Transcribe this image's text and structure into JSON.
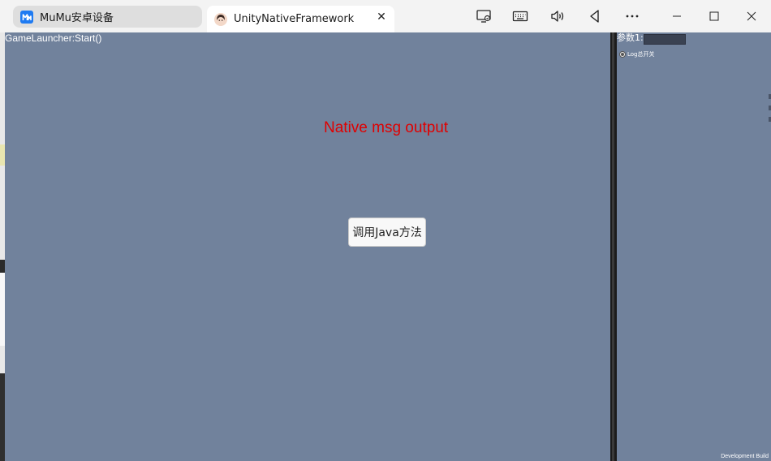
{
  "titlebar": {
    "tabs": [
      {
        "label": "MuMu安卓设备",
        "icon": "mumu-logo-icon"
      },
      {
        "label": "UnityNativeFramework",
        "icon": "avatar-icon",
        "close": "✕"
      }
    ],
    "toolbar_icons": [
      "screen-share-icon",
      "keyboard-icon",
      "volume-icon",
      "back-icon",
      "more-icon"
    ],
    "window_controls": [
      "minimize-icon",
      "maximize-icon",
      "close-icon"
    ]
  },
  "game": {
    "launcher_text": "GameLauncher:Start()",
    "native_msg": "Native msg output",
    "java_button": "调用Java方法",
    "colors": {
      "background": "#71829c",
      "native_msg": "#e00000"
    }
  },
  "panel": {
    "param_label": "参数1:",
    "param_value": "",
    "log_toggle_label": "Log总开关",
    "dev_build": "Development Build"
  }
}
